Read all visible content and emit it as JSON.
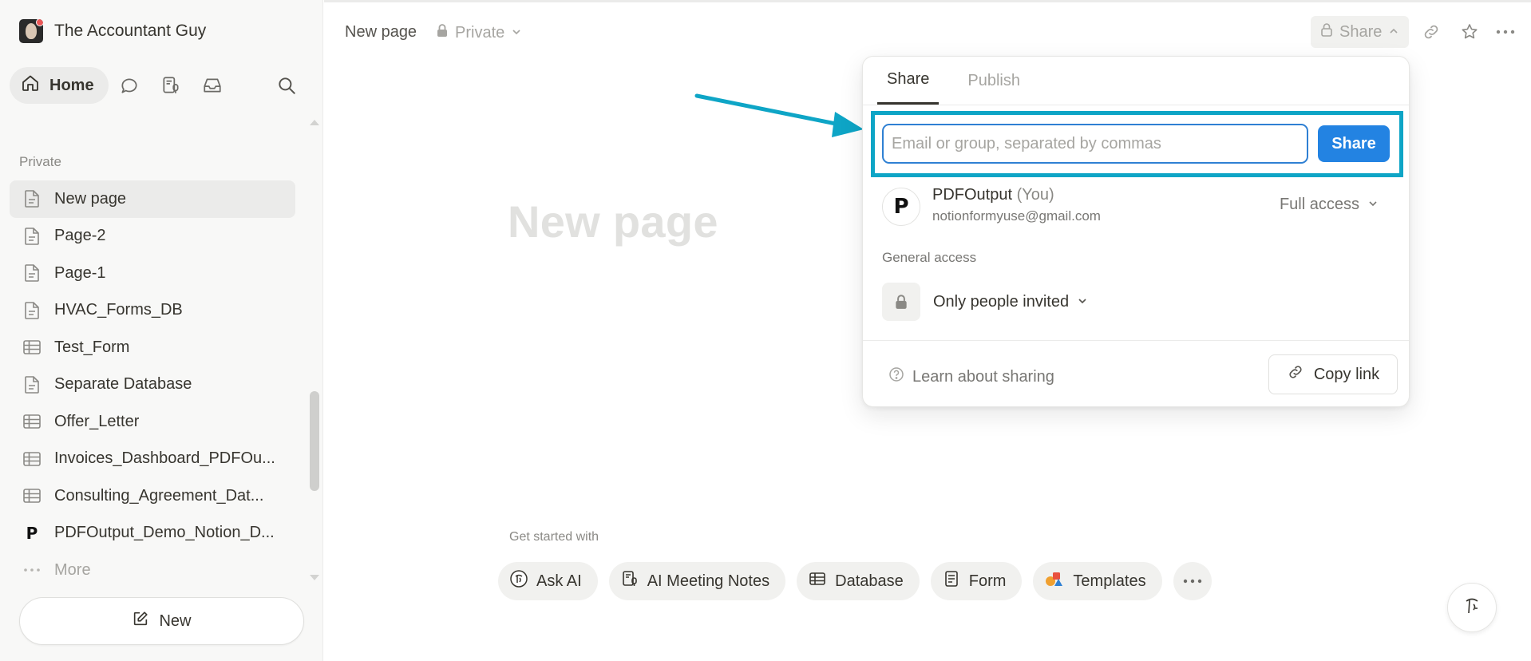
{
  "workspace": {
    "name": "The Accountant Guy"
  },
  "nav": {
    "home_label": "Home"
  },
  "sidebar": {
    "section_label": "Private",
    "pages": [
      {
        "label": "New page",
        "icon": "document-icon",
        "active": true
      },
      {
        "label": "Page-2",
        "icon": "document-icon"
      },
      {
        "label": "Page-1",
        "icon": "document-icon"
      },
      {
        "label": "HVAC_Forms_DB",
        "icon": "document-icon"
      },
      {
        "label": "Test_Form",
        "icon": "table-icon"
      },
      {
        "label": "Separate Database",
        "icon": "document-icon"
      },
      {
        "label": "Offer_Letter",
        "icon": "table-icon"
      },
      {
        "label": "Invoices_Dashboard_PDFOu...",
        "icon": "table-icon"
      },
      {
        "label": "Consulting_Agreement_Dat...",
        "icon": "table-icon"
      },
      {
        "label": "PDFOutput_Demo_Notion_D...",
        "icon": "p-logo-icon"
      }
    ],
    "more_label": "More",
    "new_label": "New"
  },
  "topbar": {
    "breadcrumb": "New page",
    "privacy": "Private",
    "share_label": "Share"
  },
  "main": {
    "title_placeholder": "New page",
    "get_started_label": "Get started with",
    "chips": [
      {
        "label": "Ask AI"
      },
      {
        "label": "AI Meeting Notes"
      },
      {
        "label": "Database"
      },
      {
        "label": "Form"
      },
      {
        "label": "Templates"
      }
    ]
  },
  "share_popover": {
    "tabs": [
      {
        "label": "Share",
        "active": true
      },
      {
        "label": "Publish",
        "active": false
      }
    ],
    "email_placeholder": "Email or group, separated by commas",
    "email_value": "",
    "share_button": "Share",
    "member": {
      "name": "PDFOutput",
      "you_tag": "(You)",
      "email": "notionformyuse@gmail.com",
      "access": "Full access",
      "avatar_letter": "P"
    },
    "general_access_label": "General access",
    "general_access_value": "Only people invited",
    "learn_label": "Learn about sharing",
    "copy_link_label": "Copy link"
  },
  "colors": {
    "accent": "#2383e2",
    "highlight": "#0ea5c6",
    "sidebar_bg": "#f8f8f7"
  }
}
